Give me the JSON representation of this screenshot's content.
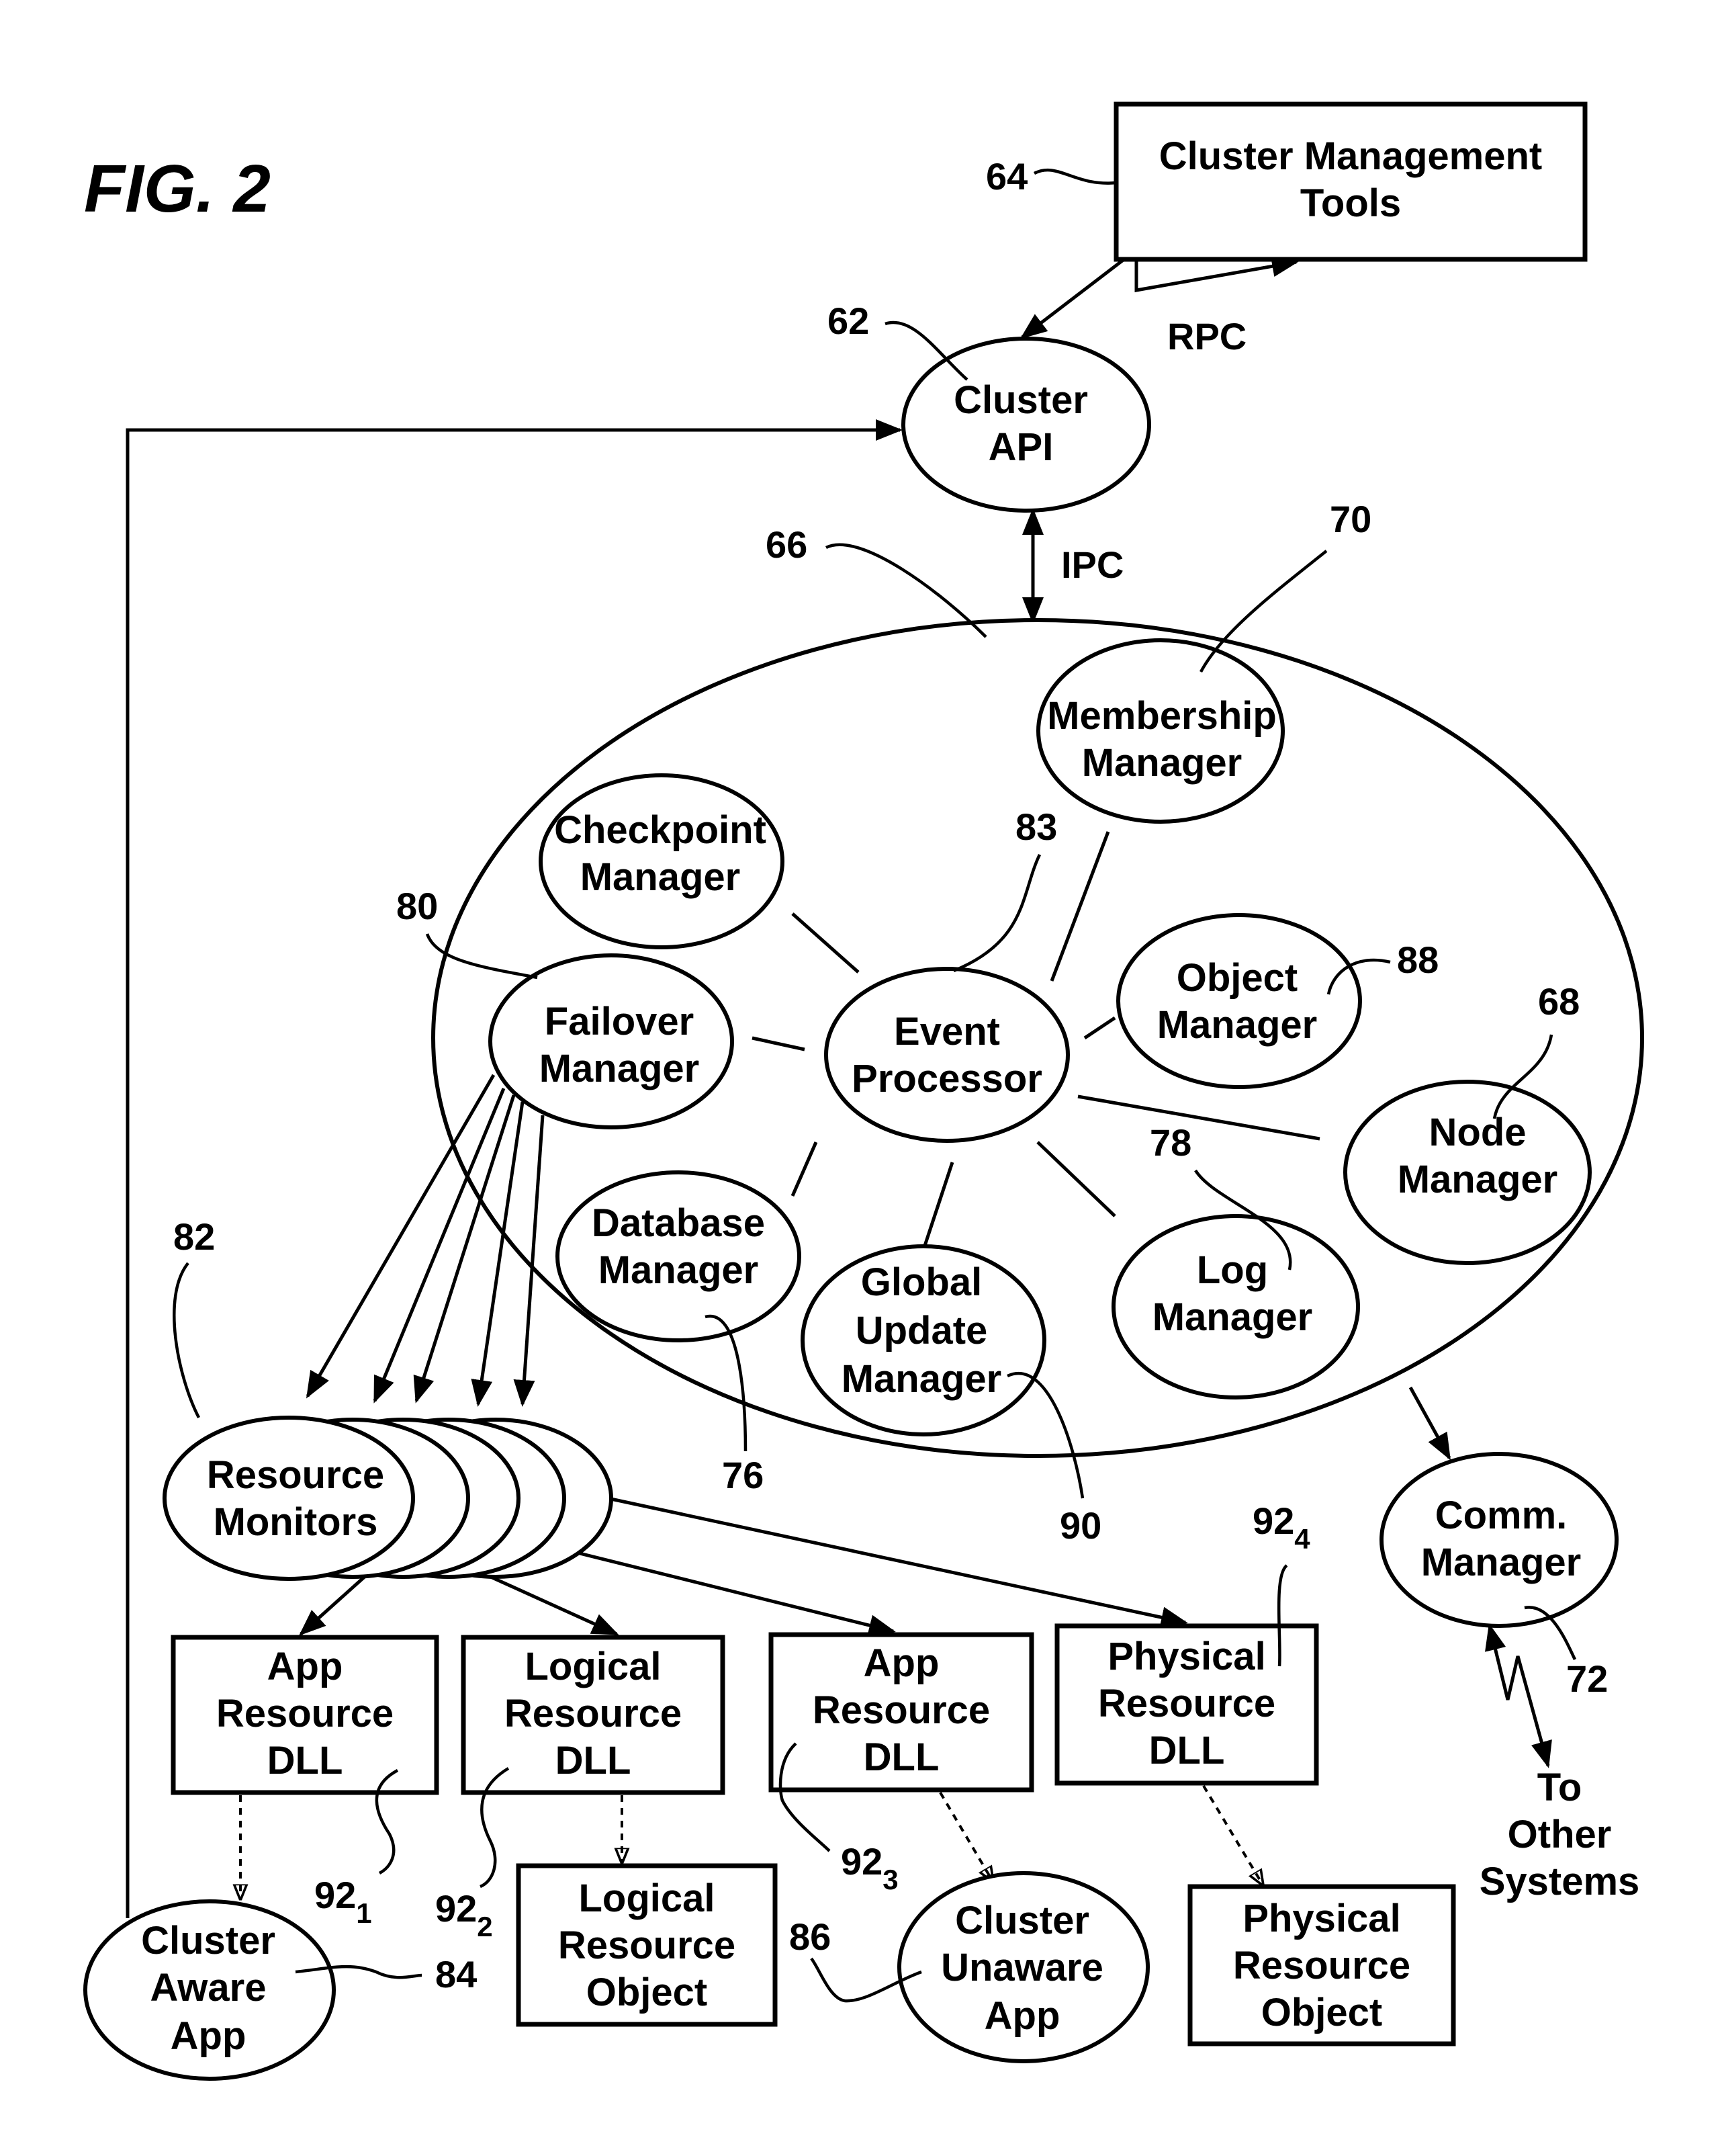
{
  "figure": {
    "title": "FIG. 2"
  },
  "nodes": {
    "cluster_mgmt_tools": {
      "lines": [
        "Cluster Management",
        "Tools"
      ],
      "ref": "64"
    },
    "cluster_api": {
      "lines": [
        "Cluster",
        "API"
      ],
      "ref": "62"
    },
    "cluster_service": {
      "ref": "66"
    },
    "membership_manager": {
      "lines": [
        "Membership",
        "Manager"
      ],
      "ref": "70"
    },
    "checkpoint_manager": {
      "lines": [
        "Checkpoint",
        "Manager"
      ]
    },
    "failover_manager": {
      "lines": [
        "Failover",
        "Manager"
      ],
      "ref": "80"
    },
    "event_processor": {
      "lines": [
        "Event",
        "Processor"
      ],
      "ref": "83"
    },
    "object_manager": {
      "lines": [
        "Object",
        "Manager"
      ],
      "ref": "88"
    },
    "node_manager": {
      "lines": [
        "Node",
        "Manager"
      ],
      "ref": "68"
    },
    "database_manager": {
      "lines": [
        "Database",
        "Manager"
      ],
      "ref": "76"
    },
    "global_update_manager": {
      "lines": [
        "Global",
        "Update",
        "Manager"
      ],
      "ref": "90"
    },
    "log_manager": {
      "lines": [
        "Log",
        "Manager"
      ],
      "ref": "78"
    },
    "resource_monitors": {
      "lines": [
        "Resource",
        "Monitors"
      ],
      "ref": "82"
    },
    "comm_manager": {
      "lines": [
        "Comm.",
        "Manager"
      ],
      "ref": "72"
    },
    "app_resource_dll_1": {
      "lines": [
        "App",
        "Resource",
        "DLL"
      ],
      "ref": "92",
      "ref_sub": "1"
    },
    "logical_resource_dll": {
      "lines": [
        "Logical",
        "Resource",
        "DLL"
      ],
      "ref": "92",
      "ref_sub": "2"
    },
    "app_resource_dll_3": {
      "lines": [
        "App",
        "Resource",
        "DLL"
      ],
      "ref": "92",
      "ref_sub": "3"
    },
    "physical_resource_dll": {
      "lines": [
        "Physical",
        "Resource",
        "DLL"
      ],
      "ref": "92",
      "ref_sub": "4"
    },
    "cluster_aware_app": {
      "lines": [
        "Cluster",
        "Aware",
        "App"
      ],
      "ref": "84"
    },
    "logical_resource_object": {
      "lines": [
        "Logical",
        "Resource",
        "Object"
      ]
    },
    "cluster_unaware_app": {
      "lines": [
        "Cluster",
        "Unaware",
        "App"
      ],
      "ref": "86"
    },
    "physical_resource_object": {
      "lines": [
        "Physical",
        "Resource",
        "Object"
      ]
    },
    "other_systems": {
      "lines": [
        "To",
        "Other",
        "Systems"
      ]
    }
  },
  "edges": {
    "rpc_label": "RPC",
    "ipc_label": "IPC"
  }
}
